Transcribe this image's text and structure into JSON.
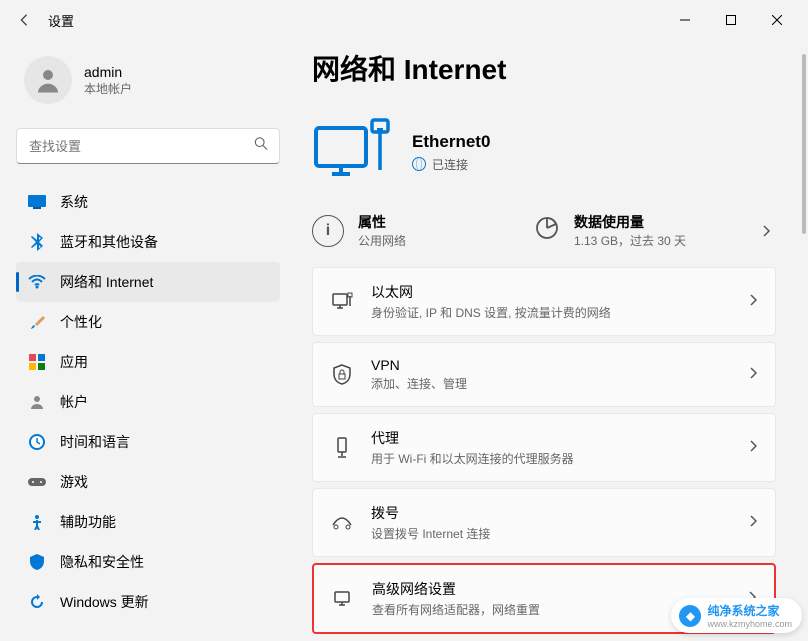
{
  "window": {
    "title": "设置"
  },
  "user": {
    "name": "admin",
    "subtitle": "本地帐户"
  },
  "search": {
    "placeholder": "查找设置"
  },
  "sidebar": {
    "items": [
      {
        "label": "系统",
        "icon": "system",
        "active": false
      },
      {
        "label": "蓝牙和其他设备",
        "icon": "bluetooth",
        "active": false
      },
      {
        "label": "网络和 Internet",
        "icon": "wifi",
        "active": true
      },
      {
        "label": "个性化",
        "icon": "brush",
        "active": false
      },
      {
        "label": "应用",
        "icon": "apps",
        "active": false
      },
      {
        "label": "帐户",
        "icon": "account",
        "active": false
      },
      {
        "label": "时间和语言",
        "icon": "time",
        "active": false
      },
      {
        "label": "游戏",
        "icon": "game",
        "active": false
      },
      {
        "label": "辅助功能",
        "icon": "ease",
        "active": false
      },
      {
        "label": "隐私和安全性",
        "icon": "privacy",
        "active": false
      },
      {
        "label": "Windows 更新",
        "icon": "update",
        "active": false
      }
    ]
  },
  "content": {
    "page_title": "网络和 Internet",
    "connection": {
      "name": "Ethernet0",
      "status": "已连接"
    },
    "info": {
      "properties": {
        "title": "属性",
        "sub": "公用网络"
      },
      "usage": {
        "title": "数据使用量",
        "sub": "1.13 GB，过去 30 天"
      }
    },
    "cards": [
      {
        "icon": "ethernet",
        "title": "以太网",
        "sub": "身份验证, IP 和 DNS 设置, 按流量计费的网络",
        "highlight": false
      },
      {
        "icon": "vpn",
        "title": "VPN",
        "sub": "添加、连接、管理",
        "highlight": false
      },
      {
        "icon": "proxy",
        "title": "代理",
        "sub": "用于 Wi-Fi 和以太网连接的代理服务器",
        "highlight": false
      },
      {
        "icon": "dialup",
        "title": "拨号",
        "sub": "设置拨号 Internet 连接",
        "highlight": false
      },
      {
        "icon": "advanced",
        "title": "高级网络设置",
        "sub": "查看所有网络适配器，网络重置",
        "highlight": true
      }
    ]
  },
  "watermark": {
    "title": "纯净系统之家",
    "url": "www.kzmyhome.com"
  }
}
